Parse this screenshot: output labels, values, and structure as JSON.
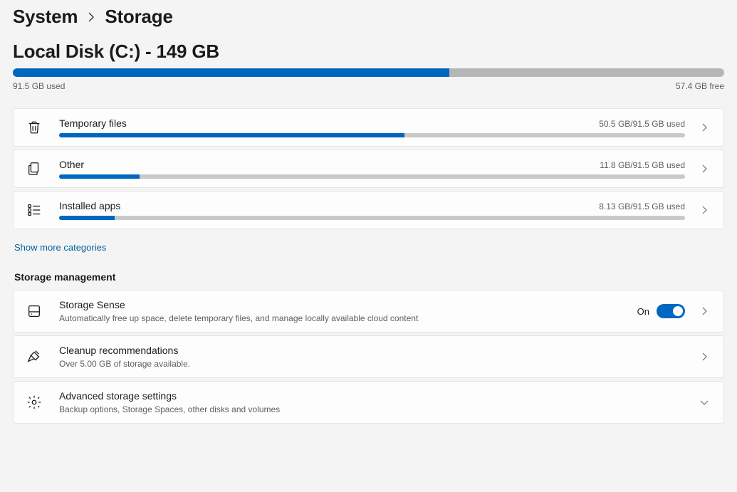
{
  "breadcrumb": {
    "parent": "System",
    "current": "Storage"
  },
  "disk": {
    "title": "Local Disk (C:) - 149 GB",
    "used_label": "91.5 GB used",
    "free_label": "57.4 GB free",
    "used_pct": 61.4
  },
  "categories": [
    {
      "icon": "trash",
      "name": "Temporary files",
      "usage": "50.5 GB/91.5 GB used",
      "pct": 55.2
    },
    {
      "icon": "other",
      "name": "Other",
      "usage": "11.8 GB/91.5 GB used",
      "pct": 12.9
    },
    {
      "icon": "apps",
      "name": "Installed apps",
      "usage": "8.13 GB/91.5 GB used",
      "pct": 8.9
    }
  ],
  "show_more": "Show more categories",
  "management_heading": "Storage management",
  "management": [
    {
      "icon": "drive",
      "title": "Storage Sense",
      "subtitle": "Automatically free up space, delete temporary files, and manage locally available cloud content",
      "toggle_state_label": "On",
      "has_toggle": true,
      "chevron": "right"
    },
    {
      "icon": "broom",
      "title": "Cleanup recommendations",
      "subtitle": "Over 5.00 GB of storage available.",
      "has_toggle": false,
      "chevron": "right"
    },
    {
      "icon": "gear",
      "title": "Advanced storage settings",
      "subtitle": "Backup options, Storage Spaces, other disks and volumes",
      "has_toggle": false,
      "chevron": "down"
    }
  ]
}
